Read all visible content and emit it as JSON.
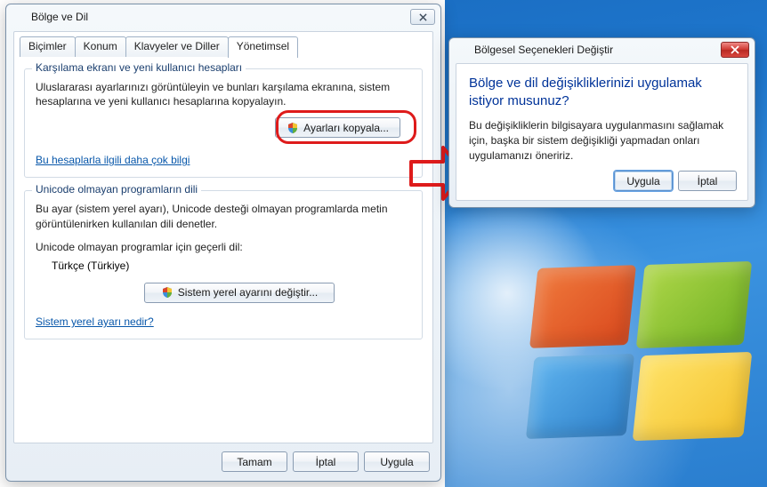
{
  "main": {
    "title": "Bölge ve Dil",
    "tabs": [
      "Biçimler",
      "Konum",
      "Klavyeler ve Diller",
      "Yönetimsel"
    ],
    "active_tab": 3,
    "group1": {
      "legend": "Karşılama ekranı ve yeni kullanıcı hesapları",
      "desc": "Uluslararası ayarlarınızı görüntüleyin ve bunları karşılama ekranına, sistem hesaplarına ve yeni kullanıcı hesaplarına kopyalayın.",
      "button": "Ayarları kopyala...",
      "link": "Bu hesaplarla ilgili daha çok bilgi"
    },
    "group2": {
      "legend": "Unicode olmayan programların dili",
      "desc": "Bu ayar (sistem yerel ayarı), Unicode desteği olmayan programlarda metin görüntülenirken kullanılan dili denetler.",
      "current_label": "Unicode olmayan programlar için geçerli dil:",
      "current_value": "Türkçe (Türkiye)",
      "button": "Sistem yerel ayarını değiştir...",
      "link": "Sistem yerel ayarı nedir?"
    },
    "buttons": {
      "ok": "Tamam",
      "cancel": "İptal",
      "apply": "Uygula"
    }
  },
  "confirm": {
    "title": "Bölgesel Seçenekleri Değiştir",
    "heading": "Bölge ve dil değişikliklerinizi uygulamak istiyor musunuz?",
    "body": "Bu değişikliklerin bilgisayara uygulanmasını sağlamak için, başka bir sistem değişikliği yapmadan onları uygulamanızı öneririz.",
    "apply": "Uygula",
    "cancel": "İptal"
  }
}
